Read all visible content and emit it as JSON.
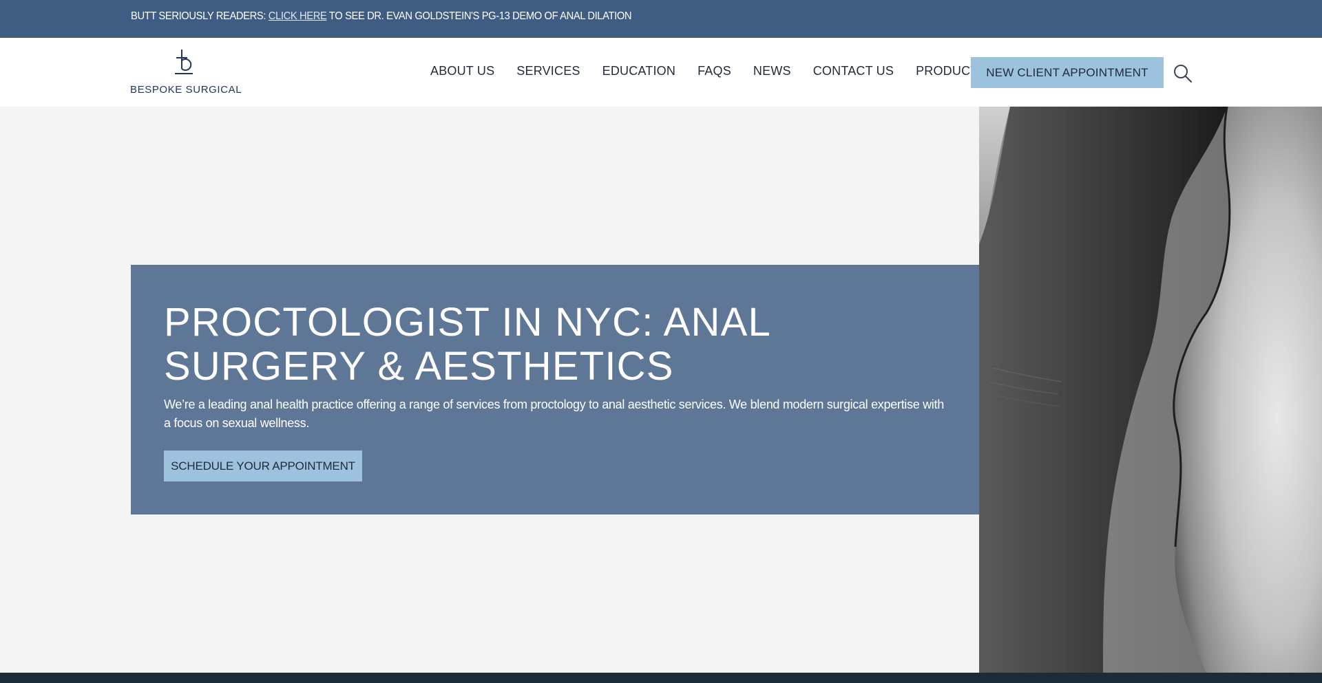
{
  "announcement": {
    "prefix": "BUTT SERIOUSLY READERS:",
    "link_text": "CLICK HERE",
    "suffix": "TO SEE DR. EVAN GOLDSTEIN'S PG-13 DEMO OF ANAL DILATION"
  },
  "logo": {
    "text": "BESPOKE SURGICAL",
    "icon": "b-monogram-icon"
  },
  "nav": {
    "items": [
      "ABOUT US",
      "SERVICES",
      "EDUCATION",
      "FAQS",
      "NEWS",
      "CONTACT US",
      "PRODUCTS"
    ],
    "cta_label": "NEW CLIENT APPOINTMENT",
    "search_icon": "search-icon"
  },
  "hero": {
    "title": "PROCTOLOGIST IN NYC: ANAL SURGERY & AESTHETICS",
    "description": "We’re a leading anal health practice offering a range of services from proctology to anal aesthetic services. We blend modern surgical expertise with a focus on sexual wellness.",
    "button_label": "SCHEDULE YOUR APPOINTMENT"
  },
  "colors": {
    "announcement_bg": "#3f5c83",
    "hero_card_bg": "#5e7797",
    "button_bg": "#9cc2dd",
    "page_bg": "#f4f4f4",
    "footer_strip": "#1d2a38"
  }
}
